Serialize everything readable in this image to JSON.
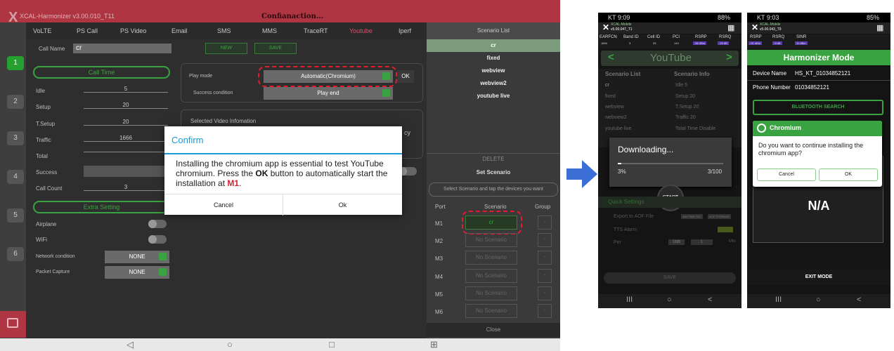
{
  "tablet": {
    "app_title": "XCAL-Harmonizer v3.00.010_T11",
    "confirm_header": "Confianaction...",
    "tabs": [
      "VoLTE",
      "PS Call",
      "PS Video",
      "Email",
      "SMS",
      "MMS",
      "TraceRT",
      "Youtube",
      "Iperf"
    ],
    "active_tab": "Youtube",
    "call_name_label": "Call Name",
    "call_name_value": "cr",
    "new_button": "NEW",
    "save_button": "SAVE",
    "call_time_label": "Call Time",
    "fields": [
      {
        "label": "Idle",
        "value": "5"
      },
      {
        "label": "Setup",
        "value": "20"
      },
      {
        "label": "T.Setup",
        "value": "20"
      },
      {
        "label": "Traffic",
        "value": "1666"
      },
      {
        "label": "Total",
        "value": ""
      },
      {
        "label": "Success",
        "value": ""
      },
      {
        "label": "Call Count",
        "value": "3"
      }
    ],
    "extra_setting_label": "Extra Setting",
    "extra": [
      {
        "label": "Airplane"
      },
      {
        "label": "WiFi"
      },
      {
        "label": "Network condition",
        "value": "NONE"
      },
      {
        "label": "Packet Capture",
        "value": "NONE"
      }
    ],
    "play_mode_label": "Play mode",
    "play_mode_value": "Automatic(Chromium)",
    "success_condition_label": "Success condition",
    "success_condition_value": "Play end",
    "ok_button": "OK",
    "selected_video_label": "Selected Video Infomation",
    "partial_text": "cy",
    "step_numbers": [
      "1",
      "2",
      "3",
      "4",
      "5",
      "6"
    ],
    "scenario_list_header": "Scenario List",
    "scenario_list": [
      "cr",
      "fixed",
      "webview",
      "webview2",
      "youtube live"
    ],
    "delete_button": "DELETE",
    "set_scenario_label": "Set Scenario",
    "set_scenario_hint": "Select Scenario and tap the devices you want",
    "port_header": "Port",
    "scenario_header": "Scenario",
    "group_header": "Group",
    "ports": [
      {
        "port": "M1",
        "scenario": "cr",
        "group": "-"
      },
      {
        "port": "M2",
        "scenario": "No Scenario",
        "group": "-"
      },
      {
        "port": "M3",
        "scenario": "No Scenario",
        "group": "-"
      },
      {
        "port": "M4",
        "scenario": "No Scenario",
        "group": "-"
      },
      {
        "port": "M5",
        "scenario": "No Scenario",
        "group": "-"
      },
      {
        "port": "M6",
        "scenario": "No Scenario",
        "group": "-"
      }
    ],
    "close_button": "Close",
    "nav": {
      "back": "◁",
      "home": "○",
      "recent": "□",
      "extra": "⊞"
    }
  },
  "dialog": {
    "title": "Confirm",
    "msg_part1": "Installing the chromium app is essential to test YouTube chromium. Press the ",
    "msg_bold": "OK",
    "msg_part2": " button to automatically start the installation at ",
    "msg_red": "M1",
    "msg_end": ".",
    "cancel": "Cancel",
    "ok": "Ok"
  },
  "phone1": {
    "status_time": "KT 9:09",
    "status_right": "88%",
    "app_name": "XCAL-Mobile",
    "app_version": "v5.00.047_T1",
    "cells": [
      "EARFCN",
      "Band ID",
      "Cell ID",
      "PCI",
      "RSRP",
      "RSRQ"
    ],
    "cell_values": [
      "1694",
      "3",
      "33",
      "143",
      "-96 dBm",
      "-15 dB"
    ],
    "youtube_label": "YouTube",
    "scenario_list_label": "Scenario List",
    "scenario_info_label": "Scenario Info",
    "scenarios": [
      "cr",
      "fixed",
      "webview",
      "webview2",
      "youtube live"
    ],
    "info": [
      "Idle 5",
      "Setup 20",
      "T.Setup 20",
      "Traffic 20",
      "Total Time Disable"
    ],
    "downloading": "Downloading...",
    "pct": "3%",
    "progress_text": "3/100",
    "progress_fraction": 0.03,
    "start_button": "START",
    "quick_settings": "Quick Settings",
    "export_label": "Export to AOF File",
    "export_opt1": "ANYTIME TEC",
    "export_opt2": "AOF STORAGE",
    "tts_label": "TTS Alarm",
    "tts_value": "SET",
    "per_label": "Per",
    "per_value1": "1995",
    "per_value2": "1",
    "per_unit": "Min",
    "save_button": "SAVE"
  },
  "phone2": {
    "status_time": "KT 9:03",
    "status_right": "85%",
    "app_name": "XCAL-Mobile",
    "app_version": "v5.00.043_T9",
    "cells": [
      "RSRP",
      "RSRQ",
      "SINR"
    ],
    "cell_values": [
      "-91 dBm",
      "-9 dB",
      "11 dBm"
    ],
    "mode_title": "Harmonizer Mode",
    "device_name_label": "Device Name",
    "device_name": "HS_KT_01034852121",
    "phone_number_label": "Phone Number",
    "phone_number": "01034852121",
    "bt_button": "BLUETOOTH SEARCH",
    "chromium_title": "Chromium",
    "chromium_msg": "Do you want to continue installing the chromium app?",
    "cancel": "Cancel",
    "ok": "OK",
    "na": "N/A",
    "exit": "EXIT MODE"
  },
  "phone_nav": {
    "recent": "III",
    "home": "○",
    "back": "<"
  },
  "colors": {
    "accent_red": "#b03542",
    "green": "#3aa341",
    "dialog_blue": "#1a9ad6",
    "arrow": "#3b6fd6"
  }
}
